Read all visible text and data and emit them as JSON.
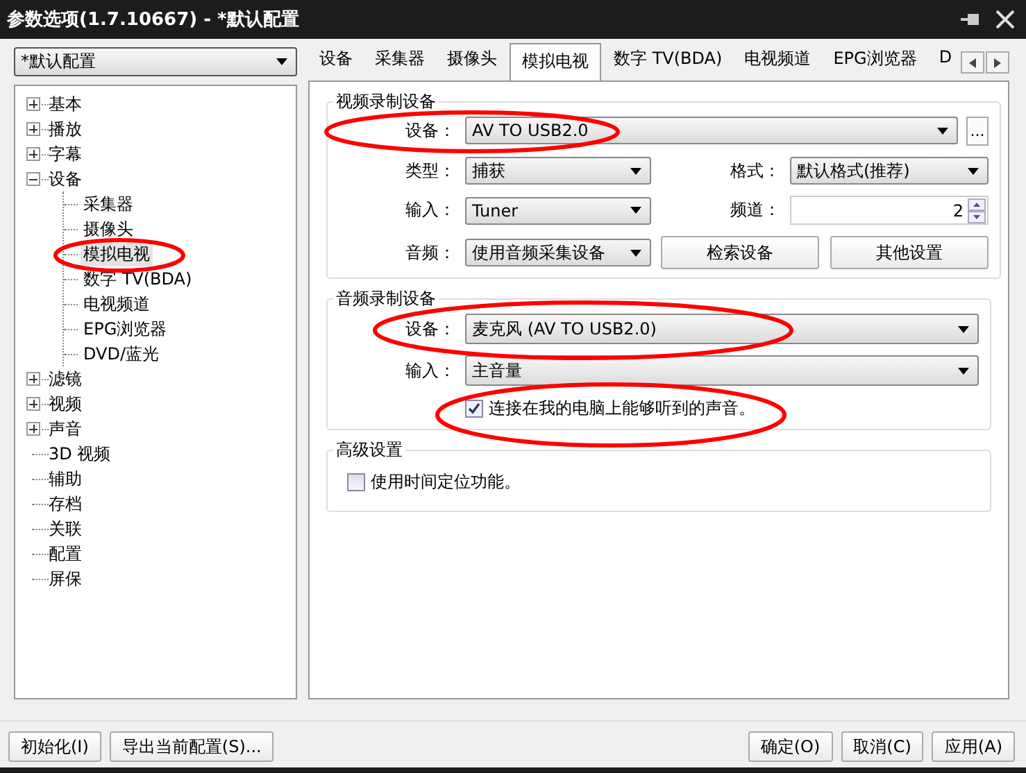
{
  "window": {
    "title": "参数选项(1.7.10667) - *默认配置"
  },
  "profile_select": {
    "value": "*默认配置"
  },
  "tree": [
    {
      "label": "基本",
      "expanded": false,
      "selected": false
    },
    {
      "label": "播放",
      "expanded": false,
      "selected": false
    },
    {
      "label": "字幕",
      "expanded": false,
      "selected": false
    },
    {
      "label": "设备",
      "expanded": true,
      "selected": false,
      "children": [
        {
          "label": "采集器",
          "selected": false
        },
        {
          "label": "摄像头",
          "selected": false
        },
        {
          "label": "模拟电视",
          "selected": true
        },
        {
          "label": "数字 TV(BDA)",
          "selected": false
        },
        {
          "label": "电视频道",
          "selected": false
        },
        {
          "label": "EPG浏览器",
          "selected": false
        },
        {
          "label": "DVD/蓝光",
          "selected": false
        }
      ]
    },
    {
      "label": "滤镜",
      "expanded": false,
      "selected": false
    },
    {
      "label": "视频",
      "expanded": false,
      "selected": false
    },
    {
      "label": "声音",
      "expanded": false,
      "selected": false
    },
    {
      "label": "3D 视频",
      "selected": false
    },
    {
      "label": "辅助",
      "selected": false
    },
    {
      "label": "存档",
      "selected": false
    },
    {
      "label": "关联",
      "selected": false
    },
    {
      "label": "配置",
      "selected": false
    },
    {
      "label": "屏保",
      "selected": false
    }
  ],
  "tabs": [
    {
      "label": "设备",
      "selected": false
    },
    {
      "label": "采集器",
      "selected": false
    },
    {
      "label": "摄像头",
      "selected": false
    },
    {
      "label": "模拟电视",
      "selected": true
    },
    {
      "label": "数字 TV(BDA)",
      "selected": false
    },
    {
      "label": "电视频道",
      "selected": false
    },
    {
      "label": "EPG浏览器",
      "selected": false
    },
    {
      "label": "D",
      "selected": false
    }
  ],
  "video_group": {
    "title": "视频录制设备",
    "device": {
      "label": "设备：",
      "value": "AV TO USB2.0",
      "browse": "..."
    },
    "type": {
      "label": "类型：",
      "value": "捕获"
    },
    "format": {
      "label": "格式：",
      "value": "默认格式(推荐)"
    },
    "input": {
      "label": "输入：",
      "value": "Tuner"
    },
    "channel": {
      "label": "频道：",
      "value": "2"
    },
    "audio": {
      "label": "音频：",
      "value": "使用音频采集设备"
    },
    "buttons": [
      "检索设备",
      "其他设置"
    ]
  },
  "audio_group": {
    "title": "音频录制设备",
    "device": {
      "label": "设备：",
      "value": "麦克风 (AV TO USB2.0)"
    },
    "input": {
      "label": "输入：",
      "value": "主音量"
    },
    "checkbox": {
      "label": "连接在我的电脑上能够听到的声音。",
      "checked": true
    }
  },
  "advanced_group": {
    "title": "高级设置",
    "checkbox": {
      "label": "使用时间定位功能。",
      "checked": false
    }
  },
  "footer": {
    "left_buttons": [
      "初始化(I)",
      "导出当前配置(S)..."
    ],
    "right_buttons": [
      "确定(O)",
      "取消(C)",
      "应用(A)"
    ]
  }
}
